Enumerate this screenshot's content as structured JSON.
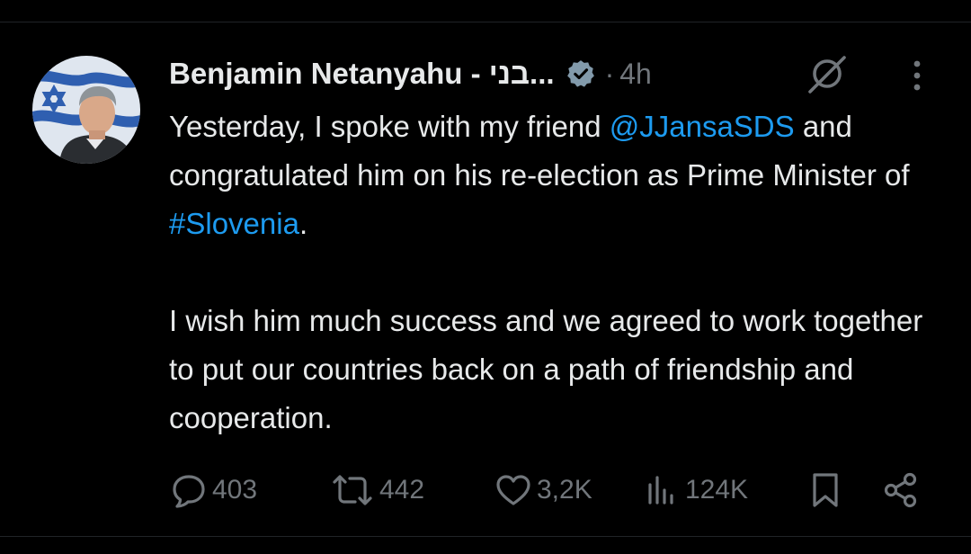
{
  "tweet": {
    "author": {
      "display_name": "Benjamin Netanyahu - בני...",
      "verified": true,
      "avatar": "avatar-photo-with-israeli-flag"
    },
    "separator": "·",
    "time": "4h",
    "text": {
      "line1_prefix": "Yesterday, I spoke with my friend ",
      "mention": "@JJansaSDS",
      "line1_mid": " and congratulated him on his re-election as Prime Minister of ",
      "hashtag": "#Slovenia",
      "line1_suffix": ".",
      "paragraph2": "I wish him much success and we agreed to work together to put our countries back on a path of friendship and cooperation."
    },
    "actions": {
      "reply_count": "403",
      "repost_count": "442",
      "like_count": "3,2K",
      "views_count": "124K"
    }
  },
  "colors": {
    "background": "#000000",
    "text_primary": "#e7e9ea",
    "text_secondary": "#71767b",
    "link": "#1d9bf0",
    "verified_badge": "#829aab"
  },
  "icons": {
    "verified": "verified-badge-icon",
    "grok": "grok-icon",
    "more": "more-options-icon",
    "reply": "reply-icon",
    "repost": "repost-icon",
    "like": "like-icon",
    "views": "views-icon",
    "bookmark": "bookmark-icon",
    "share": "share-icon"
  }
}
